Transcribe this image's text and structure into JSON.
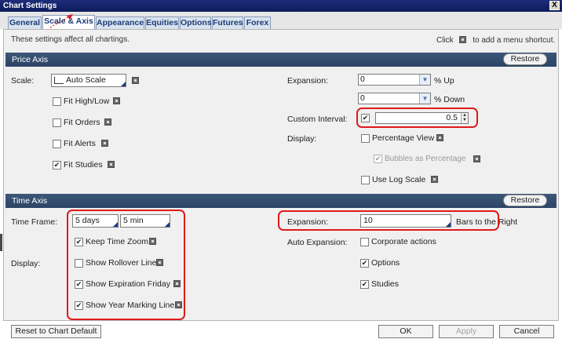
{
  "window": {
    "title": "Chart Settings",
    "close_label": "X"
  },
  "tabs": [
    "General",
    "Scale & Axis",
    "Appearance",
    "Equities",
    "Options",
    "Futures",
    "Forex"
  ],
  "info_text": "These settings affect all chartings.",
  "shortcut": {
    "prefix": "Click",
    "suffix": "to add a menu shortcut."
  },
  "price_axis": {
    "title": "Price Axis",
    "restore_label": "Restore",
    "scale_label": "Scale:",
    "scale_value": "Auto Scale",
    "checkboxes": [
      {
        "label": "Fit High/Low",
        "checked": false
      },
      {
        "label": "Fit Orders",
        "checked": false
      },
      {
        "label": "Fit Alerts",
        "checked": false
      },
      {
        "label": "Fit Studies",
        "checked": true
      }
    ],
    "expansion_label": "Expansion:",
    "expansion_up": "0",
    "expansion_up_unit": "% Up",
    "expansion_down": "0",
    "expansion_down_unit": "% Down",
    "custom_interval_label": "Custom Interval:",
    "custom_interval_checked": true,
    "custom_interval_value": "0.5",
    "display_label": "Display:",
    "percentage_view_label": "Percentage View",
    "percentage_view_checked": false,
    "bubbles_label": "Bubbles as Percentage",
    "bubbles_checked": true,
    "log_scale_label": "Use Log Scale",
    "log_scale_checked": false
  },
  "time_axis": {
    "title": "Time Axis",
    "restore_label": "Restore",
    "time_frame_label": "Time Frame:",
    "days_value": "5 days",
    "interval_value": "5 min",
    "keep_time_zoom_label": "Keep Time Zoom",
    "keep_time_zoom_checked": true,
    "display_label": "Display:",
    "display_checkboxes": [
      {
        "label": "Show Rollover Line",
        "checked": false
      },
      {
        "label": "Show Expiration Friday",
        "checked": true
      },
      {
        "label": "Show Year Marking Line",
        "checked": true
      }
    ],
    "expansion_label": "Expansion:",
    "expansion_value": "10",
    "expansion_unit": "Bars to the Right",
    "auto_expansion_label": "Auto Expansion:",
    "auto_checkboxes": [
      {
        "label": "Corporate actions",
        "checked": false
      },
      {
        "label": "Options",
        "checked": true
      },
      {
        "label": "Studies",
        "checked": true
      }
    ]
  },
  "footer": {
    "reset_label": "Reset to Chart Default",
    "ok_label": "OK",
    "apply_label": "Apply",
    "cancel_label": "Cancel"
  },
  "colors": {
    "highlight": "#e01a1a",
    "section_header": "#2f4a6c",
    "tab_text": "#1c3b78"
  }
}
